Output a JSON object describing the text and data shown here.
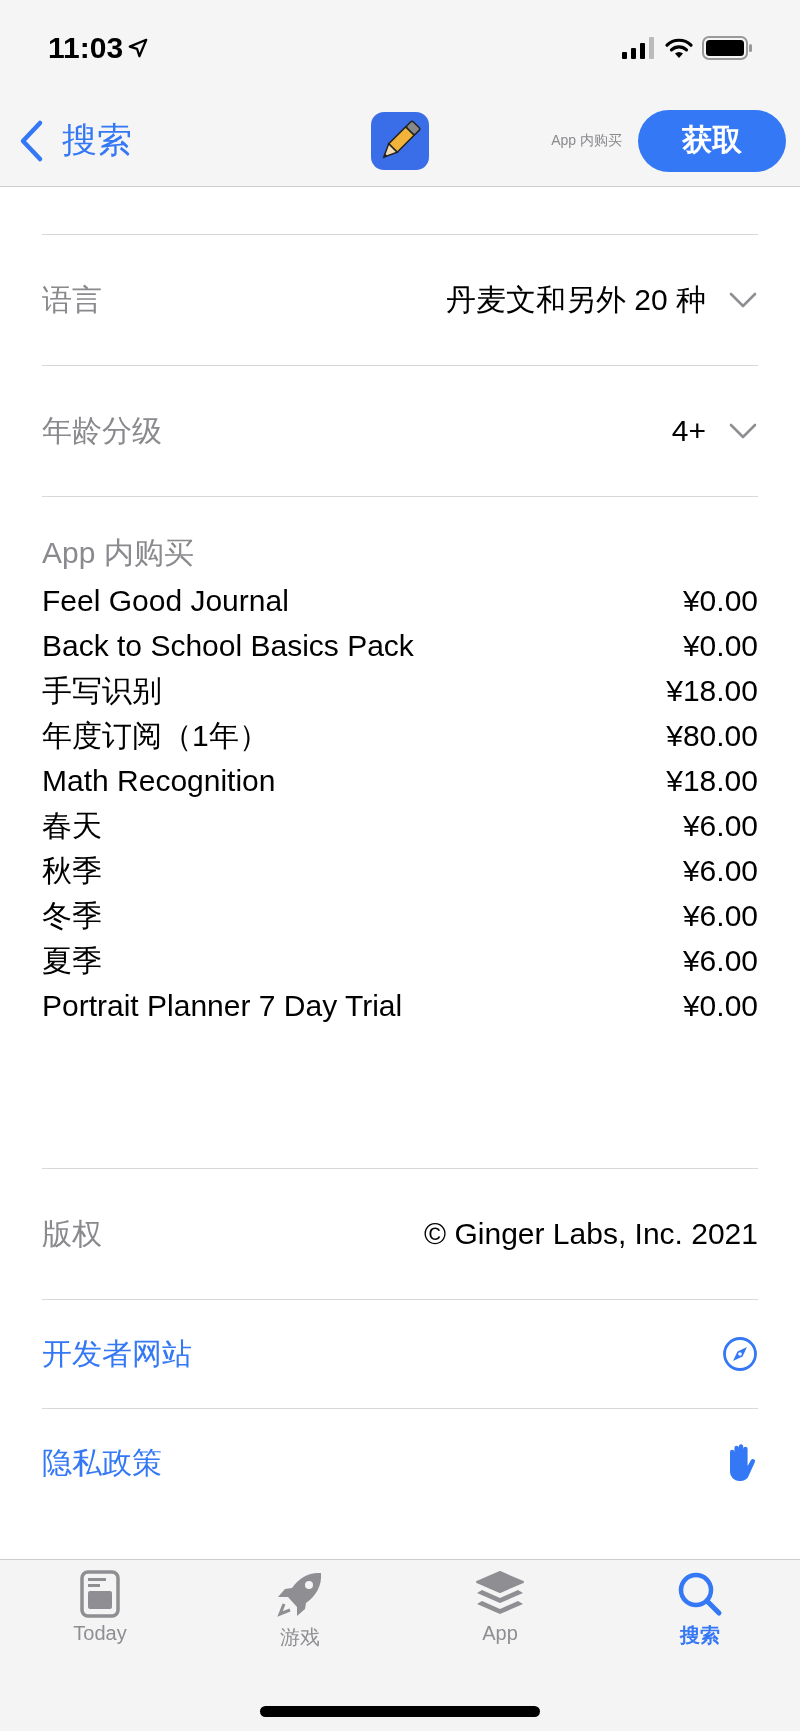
{
  "status_bar": {
    "time": "11:03"
  },
  "nav_bar": {
    "back_label": "搜索",
    "iap_note": "App 内购买",
    "get_button": "获取"
  },
  "info_rows": [
    {
      "label": "语言",
      "value": "丹麦文和另外 20 种",
      "expanded": false
    },
    {
      "label": "年龄分级",
      "value": "4+",
      "expanded": false
    }
  ],
  "in_app_purchases": {
    "title": "App 内购买",
    "items": [
      {
        "name": "Feel Good Journal",
        "price": "¥0.00"
      },
      {
        "name": "Back to School Basics Pack",
        "price": "¥0.00"
      },
      {
        "name": "手写识别",
        "price": "¥18.00"
      },
      {
        "name": "年度订阅（1年）",
        "price": "¥80.00"
      },
      {
        "name": "Math Recognition",
        "price": "¥18.00"
      },
      {
        "name": "春天",
        "price": "¥6.00"
      },
      {
        "name": "秋季",
        "price": "¥6.00"
      },
      {
        "name": "冬季",
        "price": "¥6.00"
      },
      {
        "name": "夏季",
        "price": "¥6.00"
      },
      {
        "name": "Portrait Planner 7 Day Trial",
        "price": "¥0.00"
      }
    ]
  },
  "copyright": {
    "label": "版权",
    "value": "© Ginger Labs, Inc. 2021"
  },
  "links": [
    {
      "label": "开发者网站",
      "kind": "compass"
    },
    {
      "label": "隐私政策",
      "kind": "hand"
    }
  ],
  "tab_bar": [
    {
      "label": "Today",
      "kind": "today",
      "selected": false
    },
    {
      "label": "游戏",
      "kind": "games",
      "selected": false
    },
    {
      "label": "App",
      "kind": "apps",
      "selected": false
    },
    {
      "label": "搜索",
      "kind": "search",
      "selected": true
    }
  ]
}
